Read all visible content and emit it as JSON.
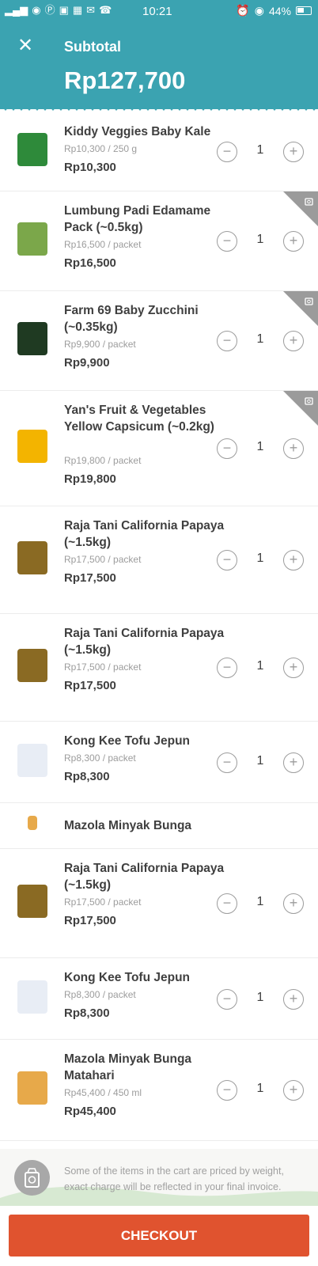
{
  "status_bar": {
    "time": "10:21",
    "battery": "44%"
  },
  "header": {
    "title": "Subtotal",
    "subtotal": "Rp127,700",
    "close_icon": "close-icon"
  },
  "colors": {
    "header": "#3ba3b1",
    "checkout": "#e0532f"
  },
  "items": [
    {
      "name": "Kiddy Veggies Baby Kale",
      "unit": "Rp10,300 / 250 g",
      "price": "Rp10,300",
      "qty": "1",
      "weighed": false,
      "thumb_color": "#2e8a3a"
    },
    {
      "name": "Lumbung Padi Edamame Pack (~0.5kg)",
      "unit": "Rp16,500 / packet",
      "price": "Rp16,500",
      "qty": "1",
      "weighed": true,
      "thumb_color": "#7ba74a"
    },
    {
      "name": "Farm 69 Baby Zucchini (~0.35kg)",
      "unit": "Rp9,900 / packet",
      "price": "Rp9,900",
      "qty": "1",
      "weighed": true,
      "thumb_color": "#1f3a22"
    },
    {
      "name": "Yan's Fruit & Vegetables Yellow Capsicum (~0.2kg)",
      "unit": "Rp19,800 / packet",
      "price": "Rp19,800",
      "qty": "1",
      "weighed": true,
      "thumb_color": "#f3b400"
    },
    {
      "name": "Raja Tani California Papaya (~1.5kg)",
      "unit": "Rp17,500 / packet",
      "price": "Rp17,500",
      "qty": "1",
      "weighed": false,
      "thumb_color": "#8a6a23"
    },
    {
      "name": "Raja Tani California Papaya (~1.5kg)",
      "unit": "Rp17,500 / packet",
      "price": "Rp17,500",
      "qty": "1",
      "weighed": false,
      "thumb_color": "#8a6a23"
    },
    {
      "name": "Kong Kee Tofu Jepun",
      "unit": "Rp8,300 / packet",
      "price": "Rp8,300",
      "qty": "1",
      "weighed": false,
      "thumb_color": "#e8edf5"
    },
    {
      "name": "Mazola Minyak Bunga",
      "unit": "",
      "price": "",
      "qty": "",
      "weighed": false,
      "thumb_color": "#e7a94a"
    },
    {
      "name": "Raja Tani California Papaya (~1.5kg)",
      "unit": "Rp17,500 / packet",
      "price": "Rp17,500",
      "qty": "1",
      "weighed": false,
      "thumb_color": "#8a6a23"
    },
    {
      "name": "Kong Kee Tofu Jepun",
      "unit": "Rp8,300 / packet",
      "price": "Rp8,300",
      "qty": "1",
      "weighed": false,
      "thumb_color": "#e8edf5"
    },
    {
      "name": "Mazola Minyak Bunga Matahari",
      "unit": "Rp45,400 / 450 ml",
      "price": "Rp45,400",
      "qty": "1",
      "weighed": false,
      "thumb_color": "#e7a94a"
    }
  ],
  "note": "Some of the items in the cart are priced by weight, exact charge will be reflected in your final invoice.",
  "checkout_label": "CHECKOUT"
}
